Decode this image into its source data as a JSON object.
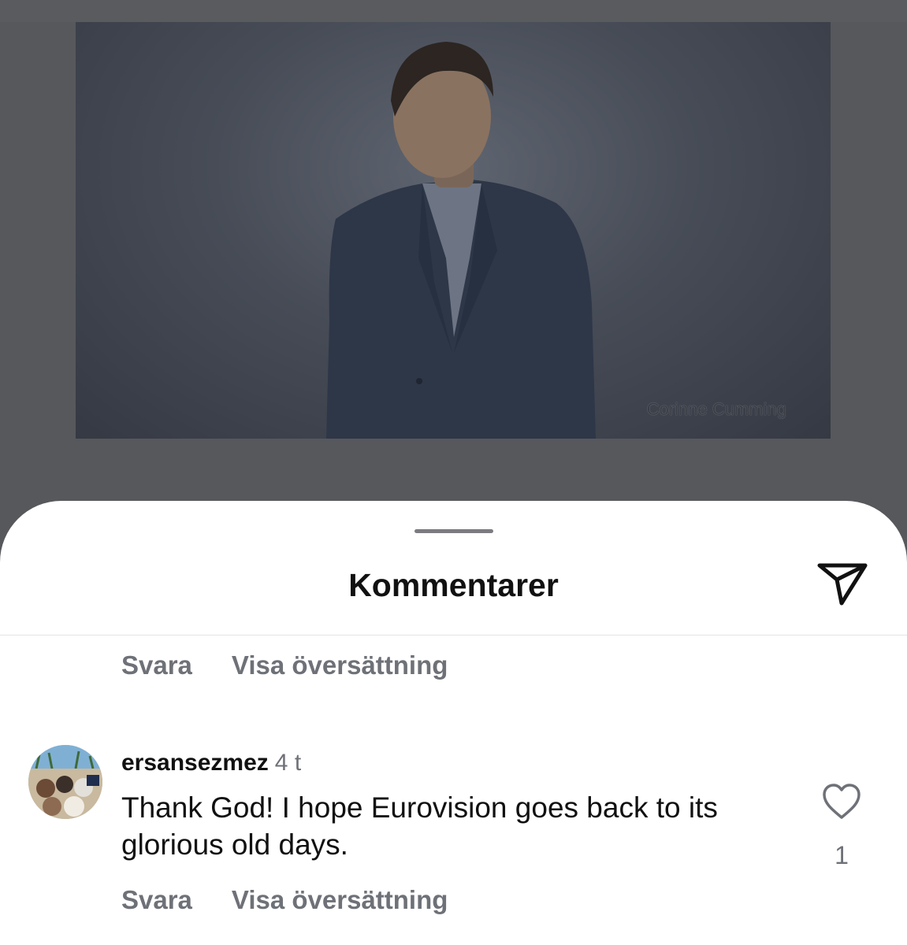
{
  "post": {
    "photo_credit": "Corinne Cumming"
  },
  "comments_sheet": {
    "title": "Kommentarer",
    "previous_comment_actions": {
      "reply": "Svara",
      "translate": "Visa översättning"
    },
    "comment": {
      "username": "ersansezmez",
      "time": "4 t",
      "text": "Thank God! I hope Eurovision goes back to its glorious old days.",
      "likes": "1",
      "reply": "Svara",
      "translate": "Visa översättning"
    }
  },
  "icons": {
    "share": "paper-plane-icon",
    "like": "heart-icon"
  }
}
